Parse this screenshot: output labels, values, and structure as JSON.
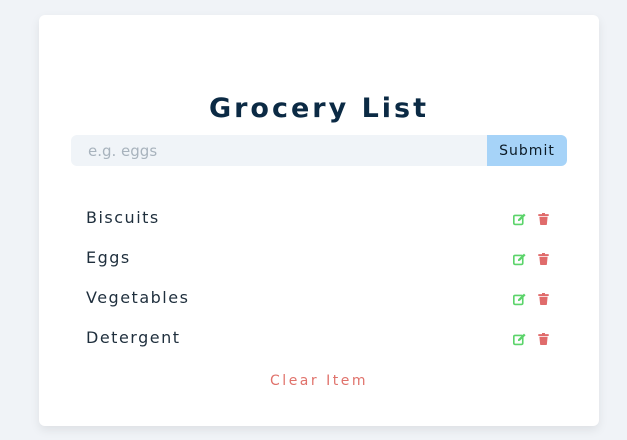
{
  "title": "Grocery List",
  "form": {
    "placeholder": "e.g. eggs",
    "value": "",
    "submit_label": "Submit"
  },
  "items": [
    {
      "name": "Biscuits"
    },
    {
      "name": "Eggs"
    },
    {
      "name": "Vegetables"
    },
    {
      "name": "Detergent"
    }
  ],
  "icons": {
    "edit": "edit-icon",
    "delete": "trash-icon"
  },
  "colors": {
    "background": "#f0f3f7",
    "card": "#ffffff",
    "title": "#0b2a44",
    "submit_bg": "#a6d3f8",
    "edit_icon": "#5bd46a",
    "delete_icon": "#e06b6b",
    "clear_text": "#e0726b"
  },
  "clear_label": "Clear Item"
}
